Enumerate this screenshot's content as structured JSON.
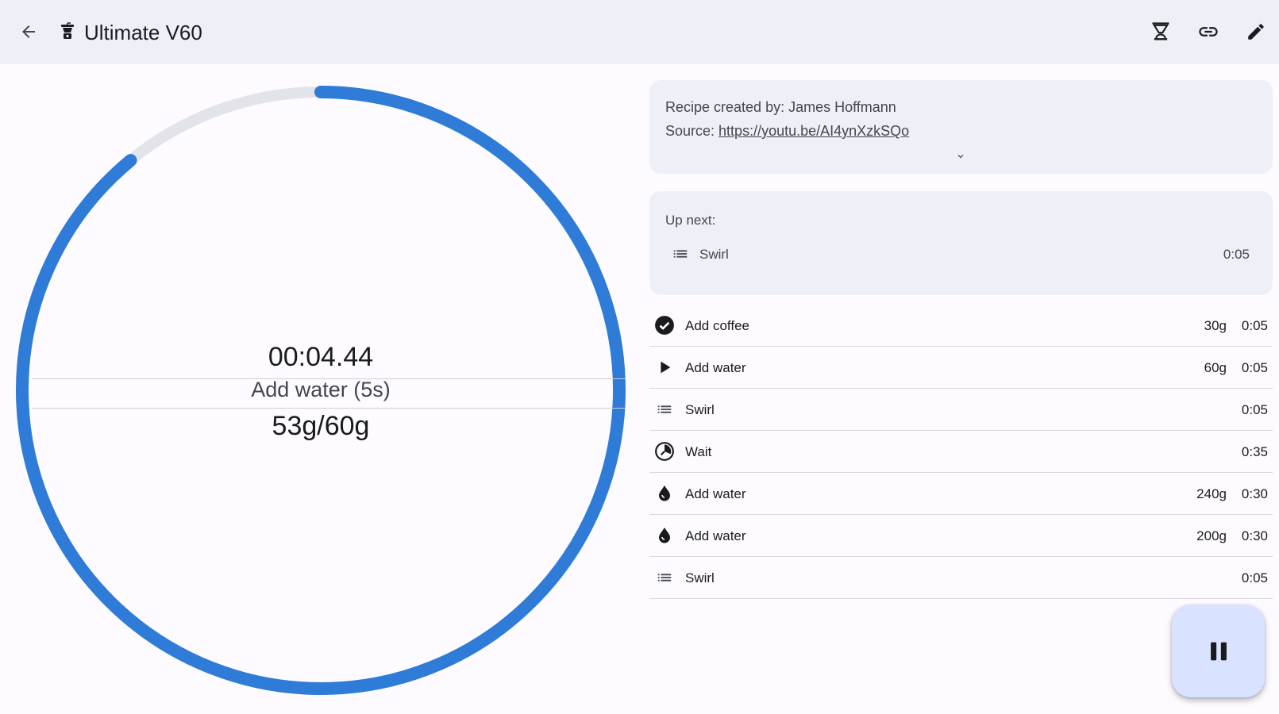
{
  "topbar": {
    "title": "Ultimate V60",
    "back_icon": "arrow-left-icon",
    "app_icon": "coffee-grinder-icon",
    "actions": [
      {
        "name": "brew-settings-button",
        "icon": "dripper-icon"
      },
      {
        "name": "share-link-button",
        "icon": "link-icon"
      },
      {
        "name": "edit-button",
        "icon": "pencil-icon"
      }
    ]
  },
  "timer": {
    "elapsed": "00:04.44",
    "current_step": "Add water (5s)",
    "weight": "53g/60g",
    "progress": 0.89,
    "colors": {
      "progress": "#2f7bd8",
      "track": "#e3e4ea"
    }
  },
  "recipe": {
    "creator_label": "Recipe created by: James Hoffmann",
    "source_prefix": "Source: ",
    "source_url": "https://youtu.be/AI4ynXzkSQo",
    "expand_icon": "chevron-down-icon"
  },
  "up_next": {
    "label": "Up next:",
    "step": {
      "icon": "list-icon",
      "name": "Swirl",
      "time": "0:05"
    }
  },
  "steps": [
    {
      "icon": "check-circle-icon",
      "name": "Add coffee",
      "amount": "30g",
      "time": "0:05"
    },
    {
      "icon": "play-icon",
      "name": "Add water",
      "amount": "60g",
      "time": "0:05"
    },
    {
      "icon": "list-icon",
      "name": "Swirl",
      "amount": "",
      "time": "0:05"
    },
    {
      "icon": "timer-icon",
      "name": "Wait",
      "amount": "",
      "time": "0:35"
    },
    {
      "icon": "water-drop-icon",
      "name": "Add water",
      "amount": "240g",
      "time": "0:30"
    },
    {
      "icon": "water-drop-icon",
      "name": "Add water",
      "amount": "200g",
      "time": "0:30"
    },
    {
      "icon": "list-icon",
      "name": "Swirl",
      "amount": "",
      "time": "0:05"
    }
  ],
  "fab": {
    "icon": "pause-icon"
  }
}
